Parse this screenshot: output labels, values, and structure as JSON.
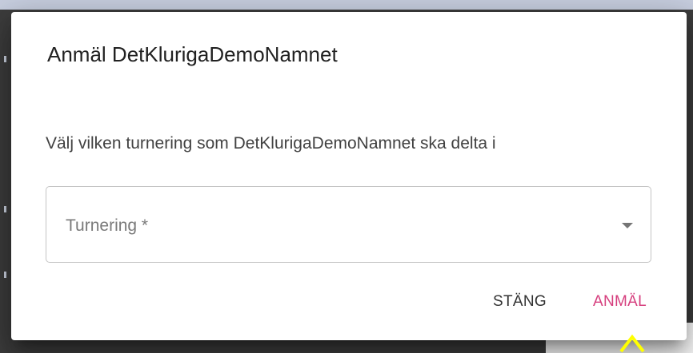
{
  "dialog": {
    "title": "Anmäl DetKlurigaDemoNamnet",
    "text": "Välj vilken turnering som DetKlurigaDemoNamnet ska delta i",
    "select": {
      "label": "Turnering *",
      "value": "",
      "icon": "arrow-drop-down-icon"
    },
    "actions": {
      "close_label": "STÄNG",
      "submit_label": "ANMÄL"
    }
  },
  "colors": {
    "accent": "#d63f7e",
    "highlight": "#ffff00",
    "backdrop": "#3d3d3d"
  }
}
